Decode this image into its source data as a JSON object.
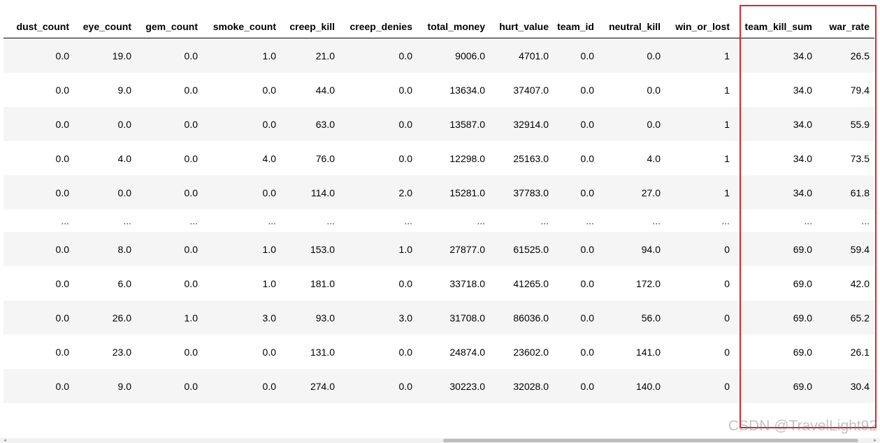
{
  "table": {
    "columns": [
      "dust_count",
      "eye_count",
      "gem_count",
      "smoke_count",
      "creep_kill",
      "creep_denies",
      "total_money",
      "hurt_value",
      "team_id",
      "neutral_kill",
      "win_or_lost",
      "team_kill_sum",
      "war_rate"
    ],
    "rows_top": [
      [
        "0.0",
        "19.0",
        "0.0",
        "1.0",
        "21.0",
        "0.0",
        "9006.0",
        "4701.0",
        "0.0",
        "0.0",
        "1",
        "34.0",
        "26.5"
      ],
      [
        "0.0",
        "9.0",
        "0.0",
        "0.0",
        "44.0",
        "0.0",
        "13634.0",
        "37407.0",
        "0.0",
        "0.0",
        "1",
        "34.0",
        "79.4"
      ],
      [
        "0.0",
        "0.0",
        "0.0",
        "0.0",
        "63.0",
        "0.0",
        "13587.0",
        "32914.0",
        "0.0",
        "0.0",
        "1",
        "34.0",
        "55.9"
      ],
      [
        "0.0",
        "4.0",
        "0.0",
        "4.0",
        "76.0",
        "0.0",
        "12298.0",
        "25163.0",
        "0.0",
        "4.0",
        "1",
        "34.0",
        "73.5"
      ],
      [
        "0.0",
        "0.0",
        "0.0",
        "0.0",
        "114.0",
        "2.0",
        "15281.0",
        "37783.0",
        "0.0",
        "27.0",
        "1",
        "34.0",
        "61.8"
      ]
    ],
    "ellipsis": "...",
    "rows_bottom": [
      [
        "0.0",
        "8.0",
        "0.0",
        "1.0",
        "153.0",
        "1.0",
        "27877.0",
        "61525.0",
        "0.0",
        "94.0",
        "0",
        "69.0",
        "59.4"
      ],
      [
        "0.0",
        "6.0",
        "0.0",
        "1.0",
        "181.0",
        "0.0",
        "33718.0",
        "41265.0",
        "0.0",
        "172.0",
        "0",
        "69.0",
        "42.0"
      ],
      [
        "0.0",
        "26.0",
        "1.0",
        "3.0",
        "93.0",
        "3.0",
        "31708.0",
        "86036.0",
        "0.0",
        "56.0",
        "0",
        "69.0",
        "65.2"
      ],
      [
        "0.0",
        "23.0",
        "0.0",
        "0.0",
        "131.0",
        "0.0",
        "24874.0",
        "23602.0",
        "0.0",
        "141.0",
        "0",
        "69.0",
        "26.1"
      ],
      [
        "0.0",
        "9.0",
        "0.0",
        "0.0",
        "274.0",
        "0.0",
        "30223.0",
        "32028.0",
        "0.0",
        "140.0",
        "0",
        "69.0",
        "30.4"
      ]
    ]
  },
  "highlight": {
    "color": "#d9262b",
    "columns": [
      "team_kill_sum",
      "war_rate"
    ]
  },
  "watermark": "CSDN @TravelLight92"
}
